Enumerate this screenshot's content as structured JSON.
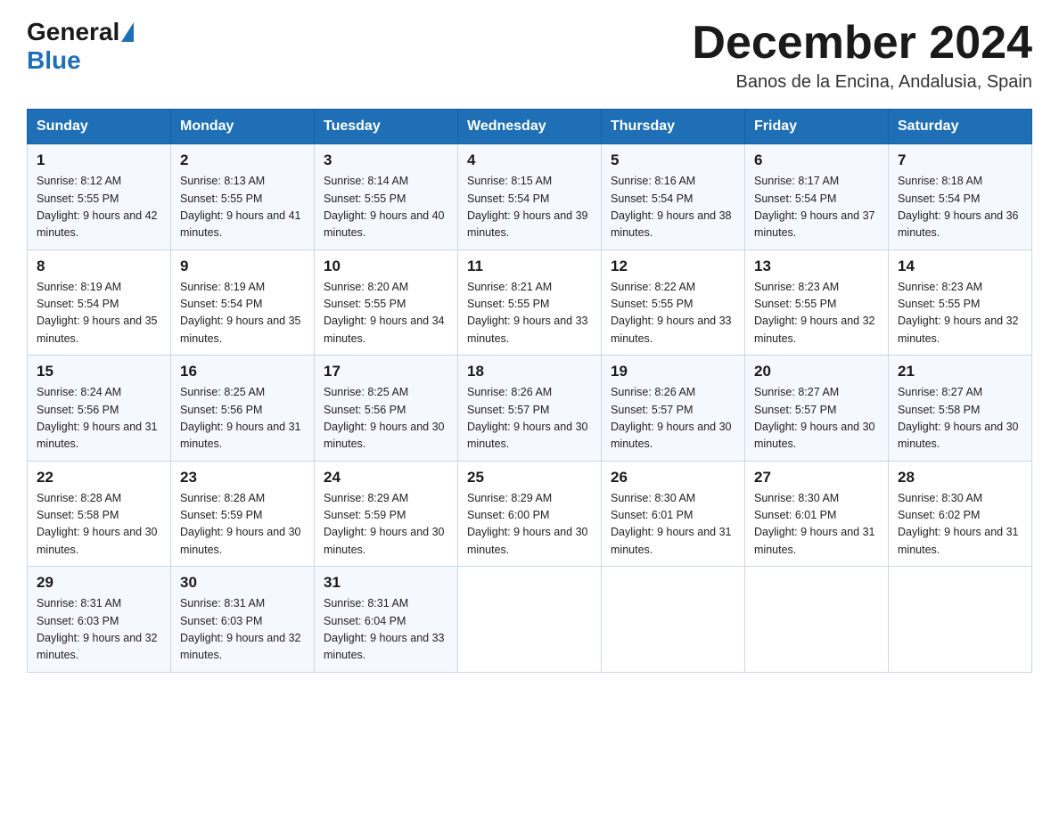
{
  "header": {
    "logo_general": "General",
    "logo_blue": "Blue",
    "month_title": "December 2024",
    "location": "Banos de la Encina, Andalusia, Spain"
  },
  "weekdays": [
    "Sunday",
    "Monday",
    "Tuesday",
    "Wednesday",
    "Thursday",
    "Friday",
    "Saturday"
  ],
  "weeks": [
    [
      {
        "day": "1",
        "sunrise": "8:12 AM",
        "sunset": "5:55 PM",
        "daylight": "9 hours and 42 minutes."
      },
      {
        "day": "2",
        "sunrise": "8:13 AM",
        "sunset": "5:55 PM",
        "daylight": "9 hours and 41 minutes."
      },
      {
        "day": "3",
        "sunrise": "8:14 AM",
        "sunset": "5:55 PM",
        "daylight": "9 hours and 40 minutes."
      },
      {
        "day": "4",
        "sunrise": "8:15 AM",
        "sunset": "5:54 PM",
        "daylight": "9 hours and 39 minutes."
      },
      {
        "day": "5",
        "sunrise": "8:16 AM",
        "sunset": "5:54 PM",
        "daylight": "9 hours and 38 minutes."
      },
      {
        "day": "6",
        "sunrise": "8:17 AM",
        "sunset": "5:54 PM",
        "daylight": "9 hours and 37 minutes."
      },
      {
        "day": "7",
        "sunrise": "8:18 AM",
        "sunset": "5:54 PM",
        "daylight": "9 hours and 36 minutes."
      }
    ],
    [
      {
        "day": "8",
        "sunrise": "8:19 AM",
        "sunset": "5:54 PM",
        "daylight": "9 hours and 35 minutes."
      },
      {
        "day": "9",
        "sunrise": "8:19 AM",
        "sunset": "5:54 PM",
        "daylight": "9 hours and 35 minutes."
      },
      {
        "day": "10",
        "sunrise": "8:20 AM",
        "sunset": "5:55 PM",
        "daylight": "9 hours and 34 minutes."
      },
      {
        "day": "11",
        "sunrise": "8:21 AM",
        "sunset": "5:55 PM",
        "daylight": "9 hours and 33 minutes."
      },
      {
        "day": "12",
        "sunrise": "8:22 AM",
        "sunset": "5:55 PM",
        "daylight": "9 hours and 33 minutes."
      },
      {
        "day": "13",
        "sunrise": "8:23 AM",
        "sunset": "5:55 PM",
        "daylight": "9 hours and 32 minutes."
      },
      {
        "day": "14",
        "sunrise": "8:23 AM",
        "sunset": "5:55 PM",
        "daylight": "9 hours and 32 minutes."
      }
    ],
    [
      {
        "day": "15",
        "sunrise": "8:24 AM",
        "sunset": "5:56 PM",
        "daylight": "9 hours and 31 minutes."
      },
      {
        "day": "16",
        "sunrise": "8:25 AM",
        "sunset": "5:56 PM",
        "daylight": "9 hours and 31 minutes."
      },
      {
        "day": "17",
        "sunrise": "8:25 AM",
        "sunset": "5:56 PM",
        "daylight": "9 hours and 30 minutes."
      },
      {
        "day": "18",
        "sunrise": "8:26 AM",
        "sunset": "5:57 PM",
        "daylight": "9 hours and 30 minutes."
      },
      {
        "day": "19",
        "sunrise": "8:26 AM",
        "sunset": "5:57 PM",
        "daylight": "9 hours and 30 minutes."
      },
      {
        "day": "20",
        "sunrise": "8:27 AM",
        "sunset": "5:57 PM",
        "daylight": "9 hours and 30 minutes."
      },
      {
        "day": "21",
        "sunrise": "8:27 AM",
        "sunset": "5:58 PM",
        "daylight": "9 hours and 30 minutes."
      }
    ],
    [
      {
        "day": "22",
        "sunrise": "8:28 AM",
        "sunset": "5:58 PM",
        "daylight": "9 hours and 30 minutes."
      },
      {
        "day": "23",
        "sunrise": "8:28 AM",
        "sunset": "5:59 PM",
        "daylight": "9 hours and 30 minutes."
      },
      {
        "day": "24",
        "sunrise": "8:29 AM",
        "sunset": "5:59 PM",
        "daylight": "9 hours and 30 minutes."
      },
      {
        "day": "25",
        "sunrise": "8:29 AM",
        "sunset": "6:00 PM",
        "daylight": "9 hours and 30 minutes."
      },
      {
        "day": "26",
        "sunrise": "8:30 AM",
        "sunset": "6:01 PM",
        "daylight": "9 hours and 31 minutes."
      },
      {
        "day": "27",
        "sunrise": "8:30 AM",
        "sunset": "6:01 PM",
        "daylight": "9 hours and 31 minutes."
      },
      {
        "day": "28",
        "sunrise": "8:30 AM",
        "sunset": "6:02 PM",
        "daylight": "9 hours and 31 minutes."
      }
    ],
    [
      {
        "day": "29",
        "sunrise": "8:31 AM",
        "sunset": "6:03 PM",
        "daylight": "9 hours and 32 minutes."
      },
      {
        "day": "30",
        "sunrise": "8:31 AM",
        "sunset": "6:03 PM",
        "daylight": "9 hours and 32 minutes."
      },
      {
        "day": "31",
        "sunrise": "8:31 AM",
        "sunset": "6:04 PM",
        "daylight": "9 hours and 33 minutes."
      },
      null,
      null,
      null,
      null
    ]
  ]
}
